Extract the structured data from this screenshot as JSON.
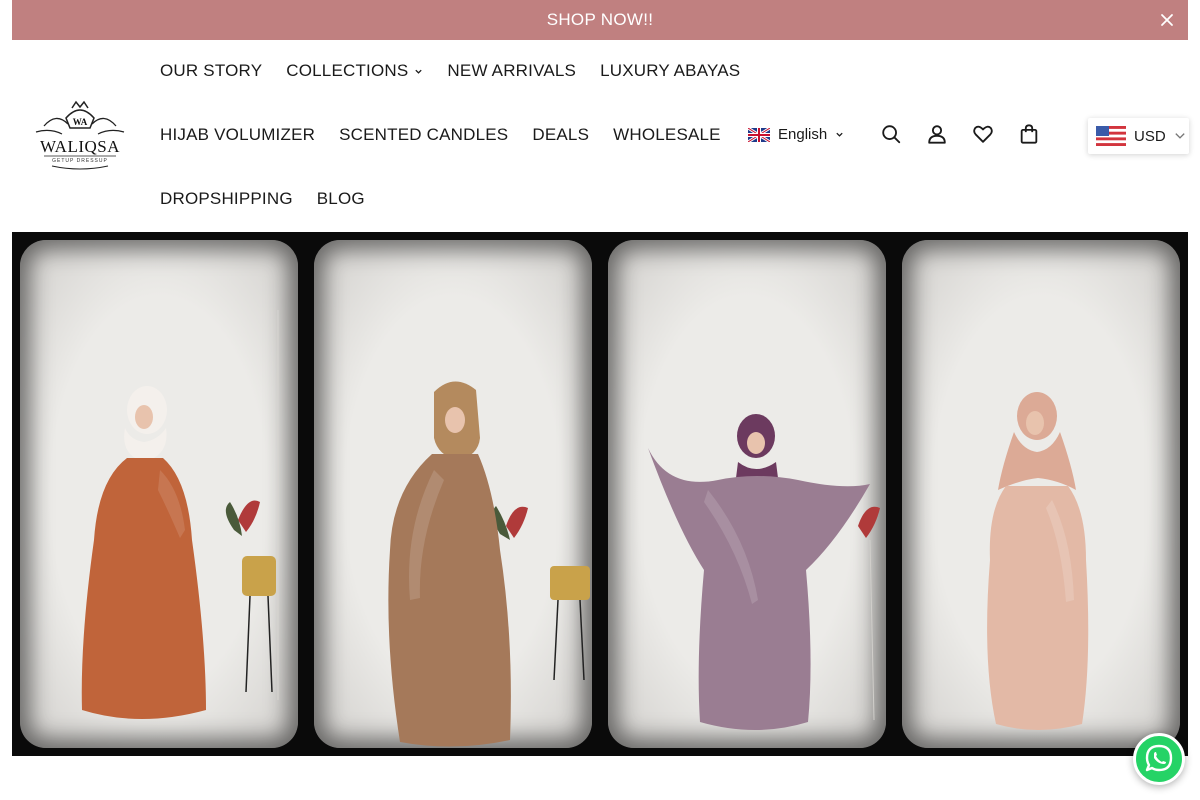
{
  "announcement": {
    "text": "SHOP NOW!!",
    "bg_color": "#c08080"
  },
  "brand": {
    "name": "WALIQSA",
    "tagline": "GETUP DRESSUP",
    "monogram": "WA"
  },
  "nav": {
    "row1": [
      {
        "label": "OUR STORY"
      },
      {
        "label": "COLLECTIONS",
        "has_dropdown": true
      },
      {
        "label": "NEW ARRIVALS"
      },
      {
        "label": "LUXURY ABAYAS"
      }
    ],
    "row2": [
      {
        "label": "HIJAB VOLUMIZER"
      },
      {
        "label": "SCENTED CANDLES"
      },
      {
        "label": "DEALS"
      },
      {
        "label": "WHOLESALE"
      }
    ],
    "row3": [
      {
        "label": "DROPSHIPPING"
      },
      {
        "label": "BLOG"
      }
    ]
  },
  "language": {
    "selected": "English",
    "flag": "uk-flag-icon"
  },
  "header_icons": [
    "search-icon",
    "account-icon",
    "wishlist-heart-icon",
    "cart-bag-icon"
  ],
  "currency": {
    "selected": "USD",
    "flag": "us-flag-icon"
  },
  "hero": {
    "abayas": [
      {
        "color": "#c0643a",
        "hijab": "#f4f0ec"
      },
      {
        "color": "#a5795a",
        "hijab": "#b48a5e"
      },
      {
        "color": "#9a7d92",
        "hijab": "#6c3a5f"
      },
      {
        "color": "#e3b9a6",
        "hijab": "#dcaa96"
      }
    ]
  },
  "whatsapp": {
    "icon": "whatsapp-icon",
    "color": "#25d366"
  }
}
